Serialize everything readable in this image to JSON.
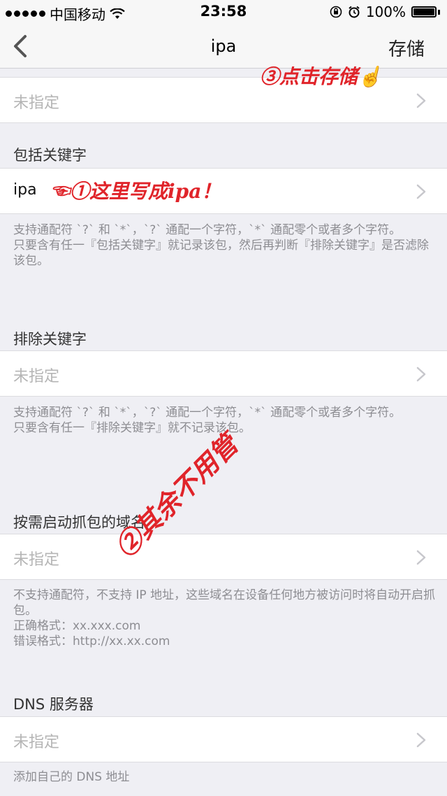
{
  "status_bar": {
    "carrier": "中国移动",
    "time": "23:58",
    "battery": "100%"
  },
  "nav": {
    "title": "ipa",
    "save_label": "存储",
    "back_icon": "chevron-left-icon"
  },
  "rows": {
    "top_value": "未指定",
    "include_value": "ipa",
    "exclude_value": "未指定",
    "domain_value": "未指定",
    "dns_value": "未指定"
  },
  "sections": {
    "include_title": "包括关键字",
    "include_note_1": "支持通配符 `?` 和 `*`，`?` 通配一个字符，`*` 通配零个或者多个字符。",
    "include_note_2": "只要含有任一『包括关键字』就记录该包，然后再判断『排除关键字』是否滤除该包。",
    "exclude_title": "排除关键字",
    "exclude_note_1": "支持通配符 `?` 和 `*`，`?` 通配一个字符，`*` 通配零个或者多个字符。",
    "exclude_note_2": "只要含有任一『排除关键字』就不记录该包。",
    "domain_title": "按需启动抓包的域名",
    "domain_note_1": "不支持通配符，不支持 IP 地址，这些域名在设备任何地方被访问时将自动开启抓包。",
    "domain_note_2": "正确格式：xx.xxx.com",
    "domain_note_3": "错误格式：http://xx.xx.com",
    "dns_title": "DNS 服务器",
    "dns_note": "添加自己的 DNS 地址"
  },
  "annotations": {
    "step1": "☜①这里写成ipa！",
    "step2": "②其余不用管",
    "step3": "③点击存储☝"
  },
  "colors": {
    "background": "#efeff4",
    "annotation": "#e0242a",
    "placeholder": "#b5b5b5"
  }
}
